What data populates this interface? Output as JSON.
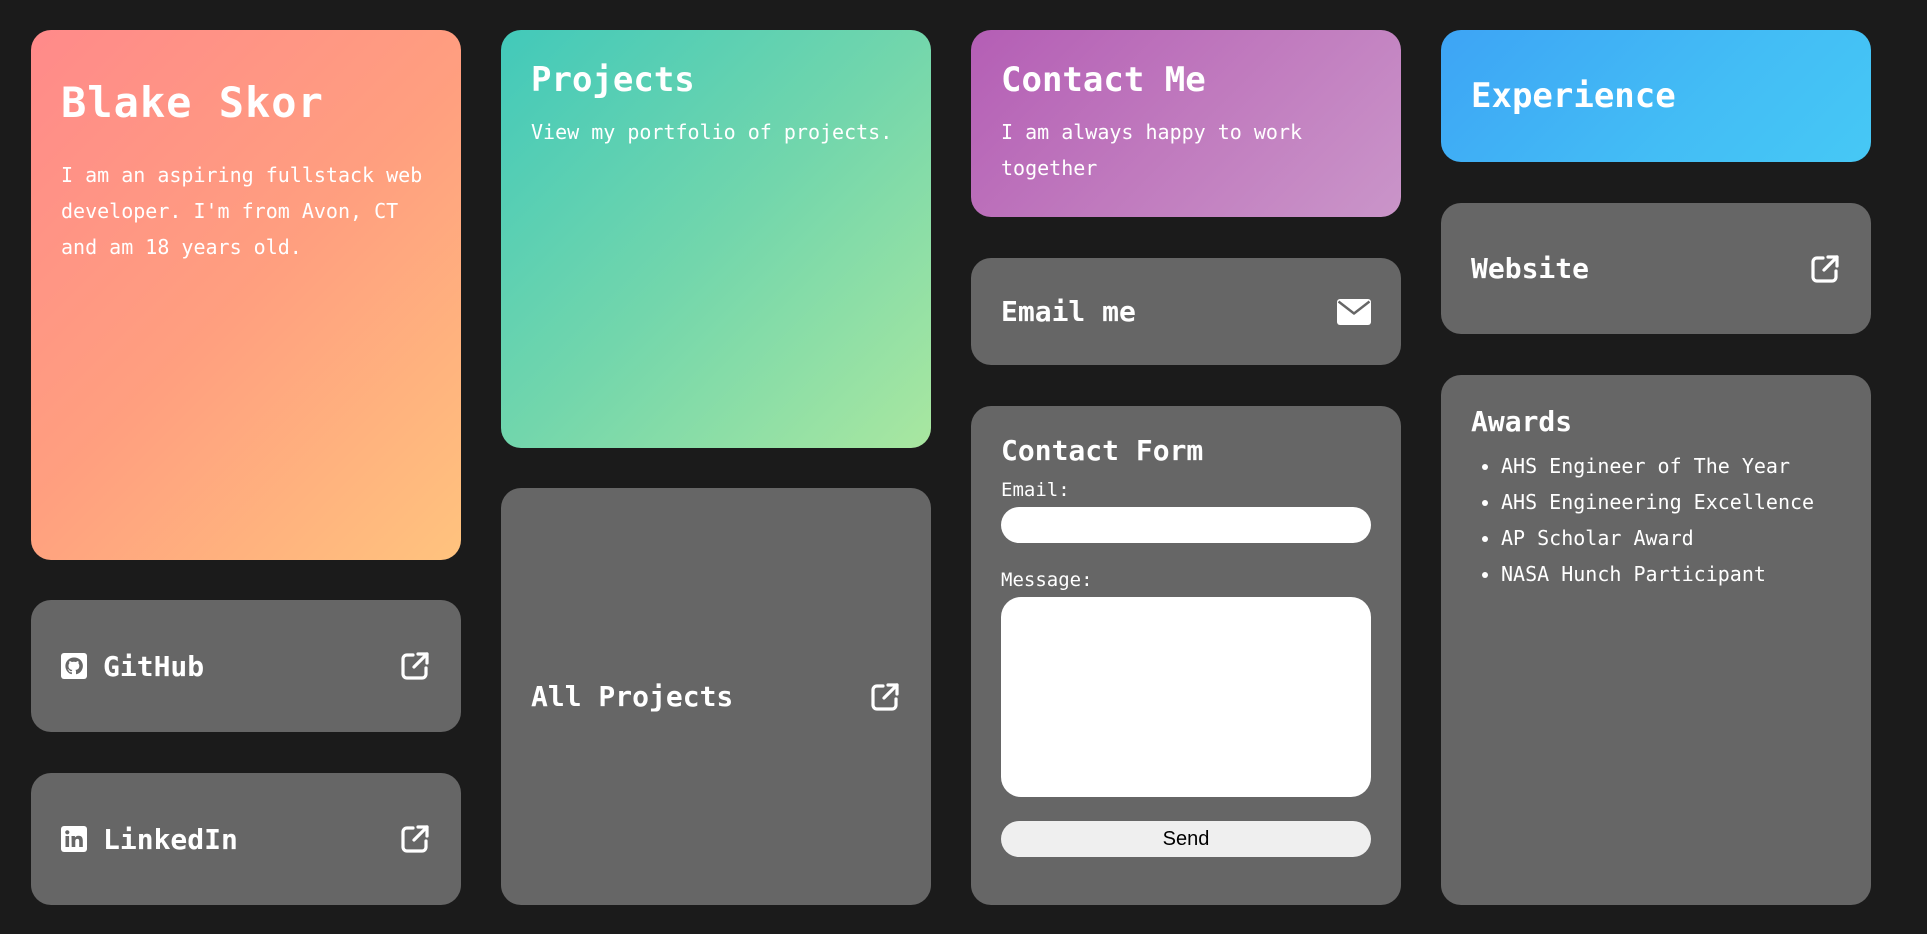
{
  "bio": {
    "name": "Blake Skor",
    "description": "I am an aspiring fullstack web developer. I'm from Avon, CT and am 18 years old."
  },
  "links": {
    "github": {
      "label": "GitHub",
      "icon": "github-icon"
    },
    "linkedin": {
      "label": "LinkedIn",
      "icon": "linkedin-icon"
    },
    "all_projects": {
      "label": "All Projects"
    },
    "email": {
      "label": "Email me",
      "icon": "envelope-icon"
    },
    "website": {
      "label": "Website"
    }
  },
  "projects": {
    "title": "Projects",
    "subtitle": "View my portfolio of projects."
  },
  "contact": {
    "title": "Contact Me",
    "subtitle": "I am always happy to work together"
  },
  "form": {
    "title": "Contact Form",
    "email_label": "Email:",
    "email_value": "",
    "message_label": "Message:",
    "message_value": "",
    "send_label": "Send"
  },
  "experience": {
    "title": "Experience"
  },
  "awards": {
    "title": "Awards",
    "items": [
      "AHS Engineer of The Year",
      "AHS Engineering Excellence",
      "AP Scholar Award",
      "NASA Hunch Participant"
    ]
  },
  "colors": {
    "background": "#1b1b1b",
    "card_gray": "#666666",
    "bio_gradient": [
      "#ff8a8a",
      "#ffc37e"
    ],
    "projects_gradient": [
      "#42c9ba",
      "#a9e7a0"
    ],
    "contact_gradient": [
      "#b45eb5",
      "#ca95c9"
    ],
    "experience_gradient": [
      "#3da4f5",
      "#46c8f5"
    ]
  }
}
